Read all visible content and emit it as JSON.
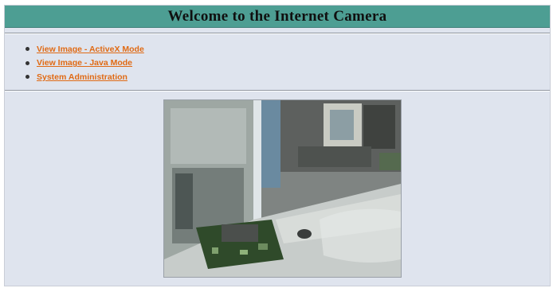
{
  "header": {
    "title": "Welcome to the Internet Camera"
  },
  "nav": {
    "links": [
      {
        "label": "View Image - ActiveX Mode"
      },
      {
        "label": "View Image - Java Mode"
      },
      {
        "label": "System Administration"
      }
    ]
  },
  "colors": {
    "title_bar": "#4d9e93",
    "page_background": "#dfe4ee",
    "link": "#e06a14"
  },
  "icons": {
    "bullet": "bullet-icon"
  }
}
